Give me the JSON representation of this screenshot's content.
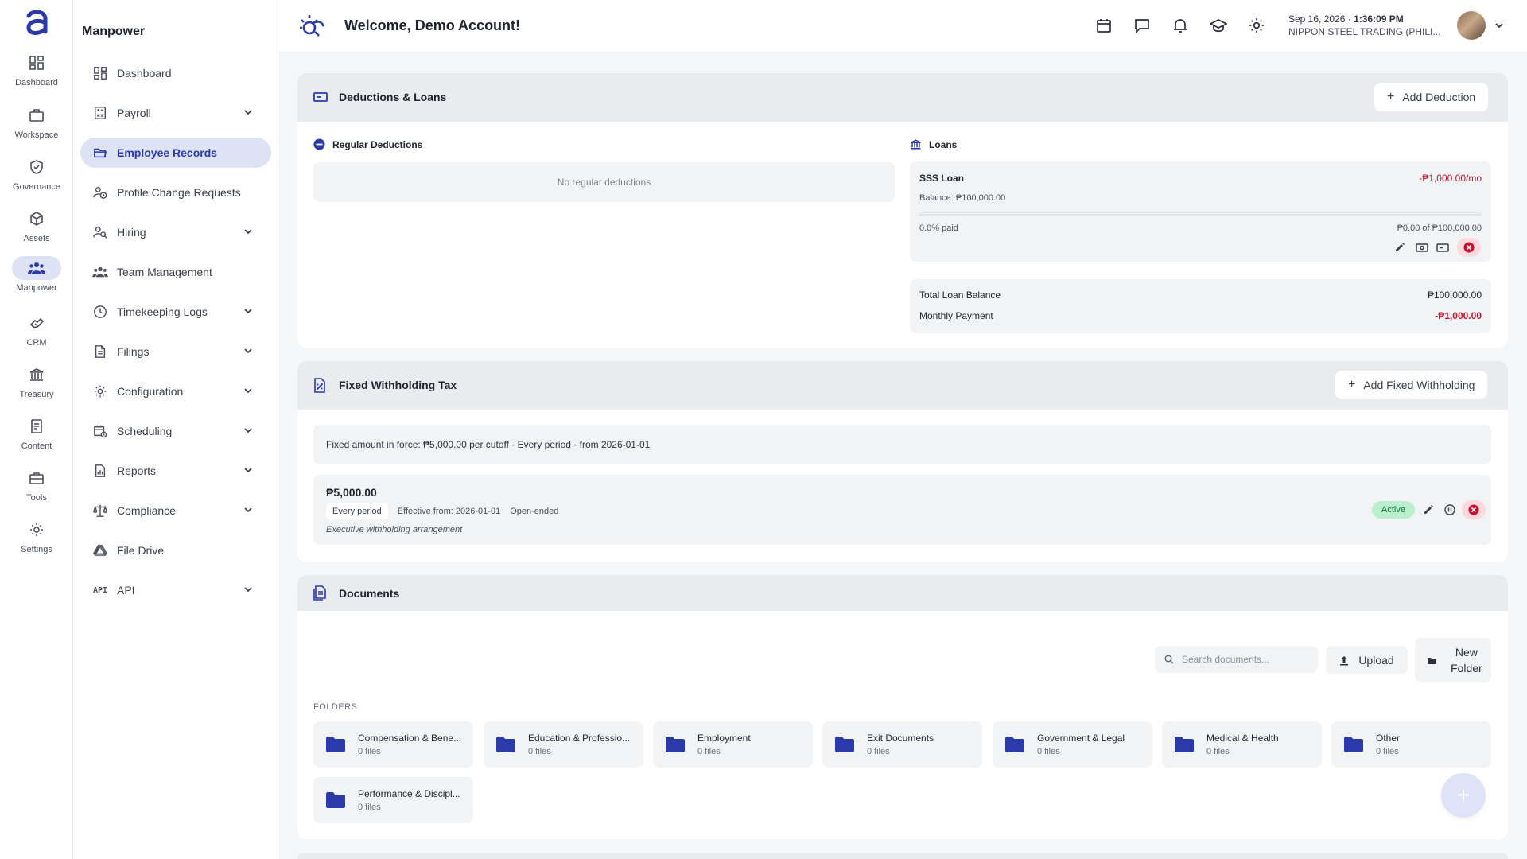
{
  "rail": {
    "items": [
      {
        "label": "Dashboard",
        "icon": "grid-icon"
      },
      {
        "label": "Workspace",
        "icon": "briefcase-icon"
      },
      {
        "label": "Governance",
        "icon": "shield-check-icon"
      },
      {
        "label": "Assets",
        "icon": "box-icon"
      },
      {
        "label": "Manpower",
        "icon": "people-icon"
      },
      {
        "label": "CRM",
        "icon": "handshake-icon"
      },
      {
        "label": "Treasury",
        "icon": "bank-icon"
      },
      {
        "label": "Content",
        "icon": "document-icon"
      },
      {
        "label": "Tools",
        "icon": "toolbox-icon"
      },
      {
        "label": "Settings",
        "icon": "gear-icon"
      }
    ],
    "active": "Manpower"
  },
  "sidebar": {
    "title": "Manpower",
    "items": [
      {
        "label": "Dashboard"
      },
      {
        "label": "Payroll"
      },
      {
        "label": "Employee Records"
      },
      {
        "label": "Profile Change Requests"
      },
      {
        "label": "Hiring"
      },
      {
        "label": "Team Management"
      },
      {
        "label": "Timekeeping Logs"
      },
      {
        "label": "Filings"
      },
      {
        "label": "Configuration"
      },
      {
        "label": "Scheduling"
      },
      {
        "label": "Reports"
      },
      {
        "label": "Compliance"
      },
      {
        "label": "File Drive"
      },
      {
        "label": "API",
        "icon_text": "API"
      }
    ]
  },
  "header": {
    "welcome": "Welcome, Demo Account!",
    "date": "Sep 16, 2026",
    "time": "1:36:09 PM",
    "company": "NIPPON STEEL TRADING (PHILI..."
  },
  "deductions": {
    "title": "Deductions & Loans",
    "add_label": "Add Deduction",
    "regular_title": "Regular Deductions",
    "regular_empty": "No regular deductions",
    "loans_title": "Loans",
    "loan": {
      "name": "SSS Loan",
      "monthly": "-₱1,000.00/mo",
      "balance": "Balance: ₱100,000.00",
      "paid_pct": "0.0% paid",
      "progress_text": "₱0.00 of ₱100,000.00",
      "progress_fraction": 0.0
    },
    "summary": {
      "total_label": "Total Loan Balance",
      "total_value": "₱100,000.00",
      "monthly_label": "Monthly Payment",
      "monthly_value": "-₱1,000.00"
    }
  },
  "withholding": {
    "title": "Fixed Withholding Tax",
    "add_label": "Add Fixed Withholding",
    "banner": "Fixed amount in force: ₱5,000.00 per cutoff · Every period · from 2026-01-01",
    "entry": {
      "amount": "₱5,000.00",
      "period": "Every period",
      "effective": "Effective from: 2026-01-01",
      "ends": "Open-ended",
      "note": "Executive withholding arrangement",
      "status": "Active"
    }
  },
  "documents": {
    "title": "Documents",
    "search_placeholder": "Search documents...",
    "upload_label": "Upload",
    "new_folder_label_1": "New",
    "new_folder_label_2": "Folder",
    "folders_label": "FOLDERS",
    "folders": [
      {
        "name": "Compensation & Bene...",
        "count": "0 files"
      },
      {
        "name": "Education & Professio...",
        "count": "0 files"
      },
      {
        "name": "Employment",
        "count": "0 files"
      },
      {
        "name": "Exit Documents",
        "count": "0 files"
      },
      {
        "name": "Government & Legal",
        "count": "0 files"
      },
      {
        "name": "Medical & Health",
        "count": "0 files"
      },
      {
        "name": "Other",
        "count": "0 files"
      },
      {
        "name": "Performance & Discipl...",
        "count": "0 files"
      }
    ],
    "fab_label": "+"
  },
  "colors": {
    "accent": "#2b3aa8",
    "active_bg": "#dde2f5",
    "negative": "#c8102e",
    "success_bg": "#b9efcc"
  }
}
